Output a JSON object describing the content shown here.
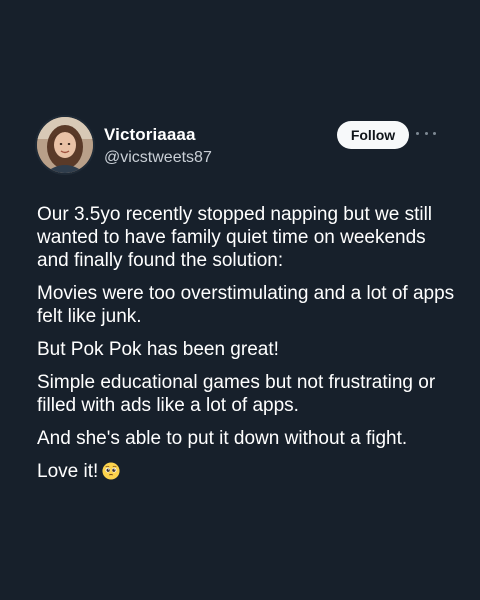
{
  "user": {
    "display_name": "Victoriaaaa",
    "handle": "@vicstweets87",
    "avatar_icon": "avatar-photo"
  },
  "actions": {
    "follow_label": "Follow",
    "more_icon": "more-options-icon"
  },
  "tweet": {
    "paragraphs": [
      "Our 3.5yo recently stopped napping but we still wanted to have family quiet time on weekends and finally found the solution:",
      "Movies were too overstimulating and a lot of apps felt like junk.",
      "But Pok Pok has been great!",
      "Simple educational games but not frustrating or filled with ads like a lot of apps.",
      "And she's able to put it down without a fight.",
      "Love it!"
    ],
    "emoji": "pleading-face-emoji"
  },
  "colors": {
    "background": "#17202b",
    "text": "#ffffff",
    "secondary_text": "#c9cfd6",
    "follow_button_bg": "#f7f9fa"
  }
}
